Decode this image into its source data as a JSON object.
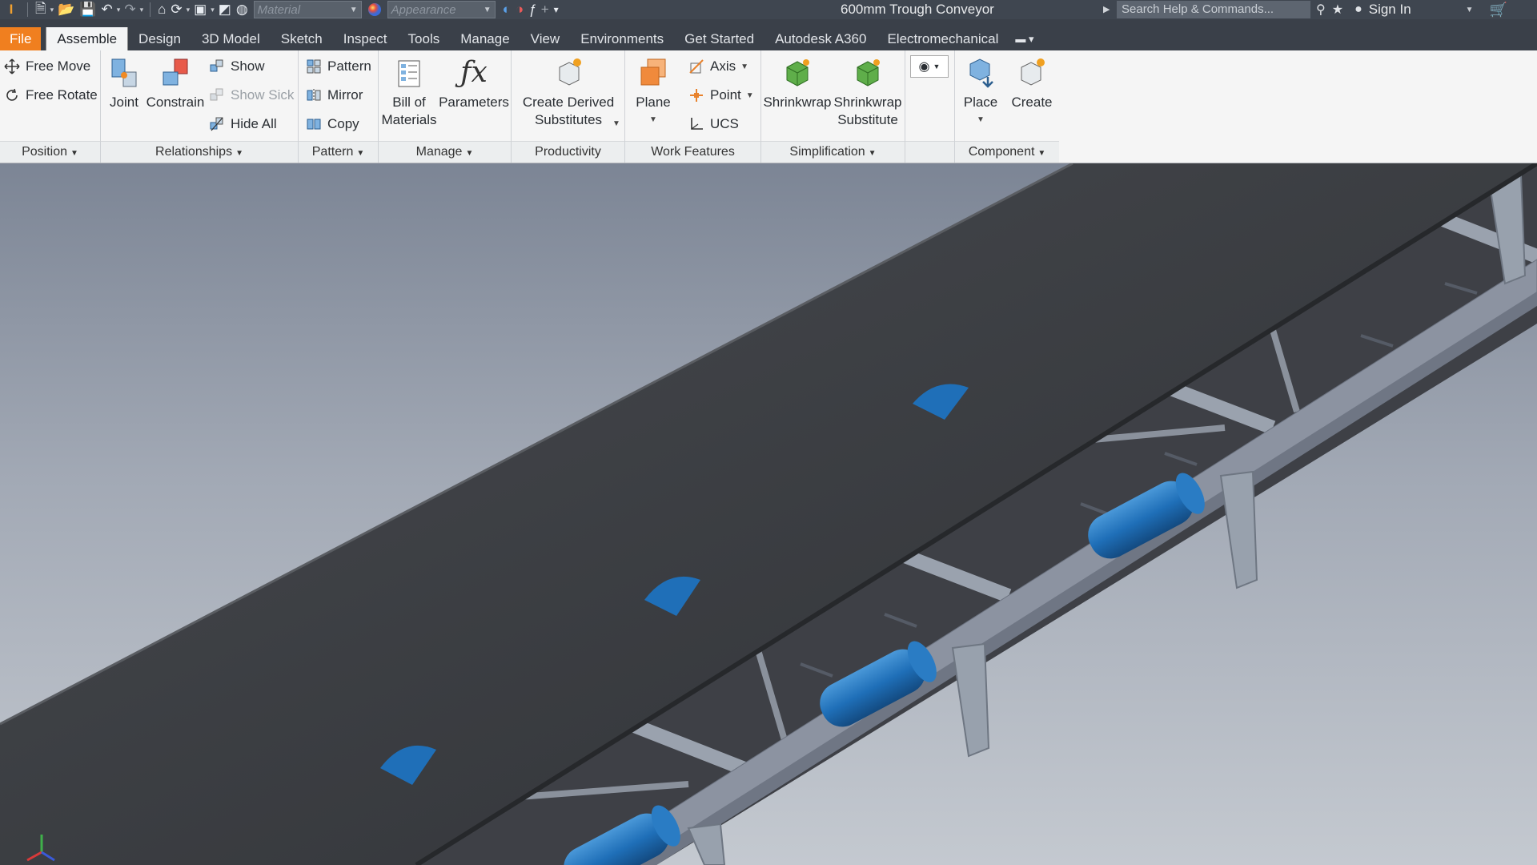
{
  "quick_access": {
    "material_placeholder": "Material",
    "appearance_placeholder": "Appearance"
  },
  "title": "600mm Trough Conveyor",
  "search": {
    "placeholder": "Search Help & Commands..."
  },
  "user": {
    "signin_label": "Sign In"
  },
  "tabs": [
    {
      "label": "File"
    },
    {
      "label": "Assemble"
    },
    {
      "label": "Design"
    },
    {
      "label": "3D Model"
    },
    {
      "label": "Sketch"
    },
    {
      "label": "Inspect"
    },
    {
      "label": "Tools"
    },
    {
      "label": "Manage"
    },
    {
      "label": "View"
    },
    {
      "label": "Environments"
    },
    {
      "label": "Get Started"
    },
    {
      "label": "Autodesk A360"
    },
    {
      "label": "Electromechanical"
    }
  ],
  "ribbon": {
    "position": {
      "label": "Position",
      "free_move": "Free Move",
      "free_rotate": "Free Rotate"
    },
    "relationships": {
      "label": "Relationships",
      "joint": "Joint",
      "constrain": "Constrain",
      "show": "Show",
      "show_sick": "Show Sick",
      "hide_all": "Hide All"
    },
    "pattern": {
      "label": "Pattern",
      "pattern": "Pattern",
      "mirror": "Mirror",
      "copy": "Copy"
    },
    "manage": {
      "label": "Manage",
      "bom_line1": "Bill of",
      "bom_line2": "Materials",
      "parameters": "Parameters"
    },
    "productivity": {
      "label": "Productivity",
      "cds_line1": "Create Derived",
      "cds_line2": "Substitutes"
    },
    "work_features": {
      "label": "Work Features",
      "plane": "Plane",
      "axis": "Axis",
      "point": "Point",
      "ucs": "UCS"
    },
    "simplification": {
      "label": "Simplification",
      "shrinkwrap": "Shrinkwrap",
      "sws_line1": "Shrinkwrap",
      "sws_line2": "Substitute"
    },
    "component": {
      "label": "Component",
      "place": "Place",
      "create": "Create"
    }
  },
  "colors": {
    "file_tab": "#f07f1f",
    "roller_blue": "#1f6fb8",
    "belt": "#3c3e42",
    "frame": "#8c93a1"
  }
}
